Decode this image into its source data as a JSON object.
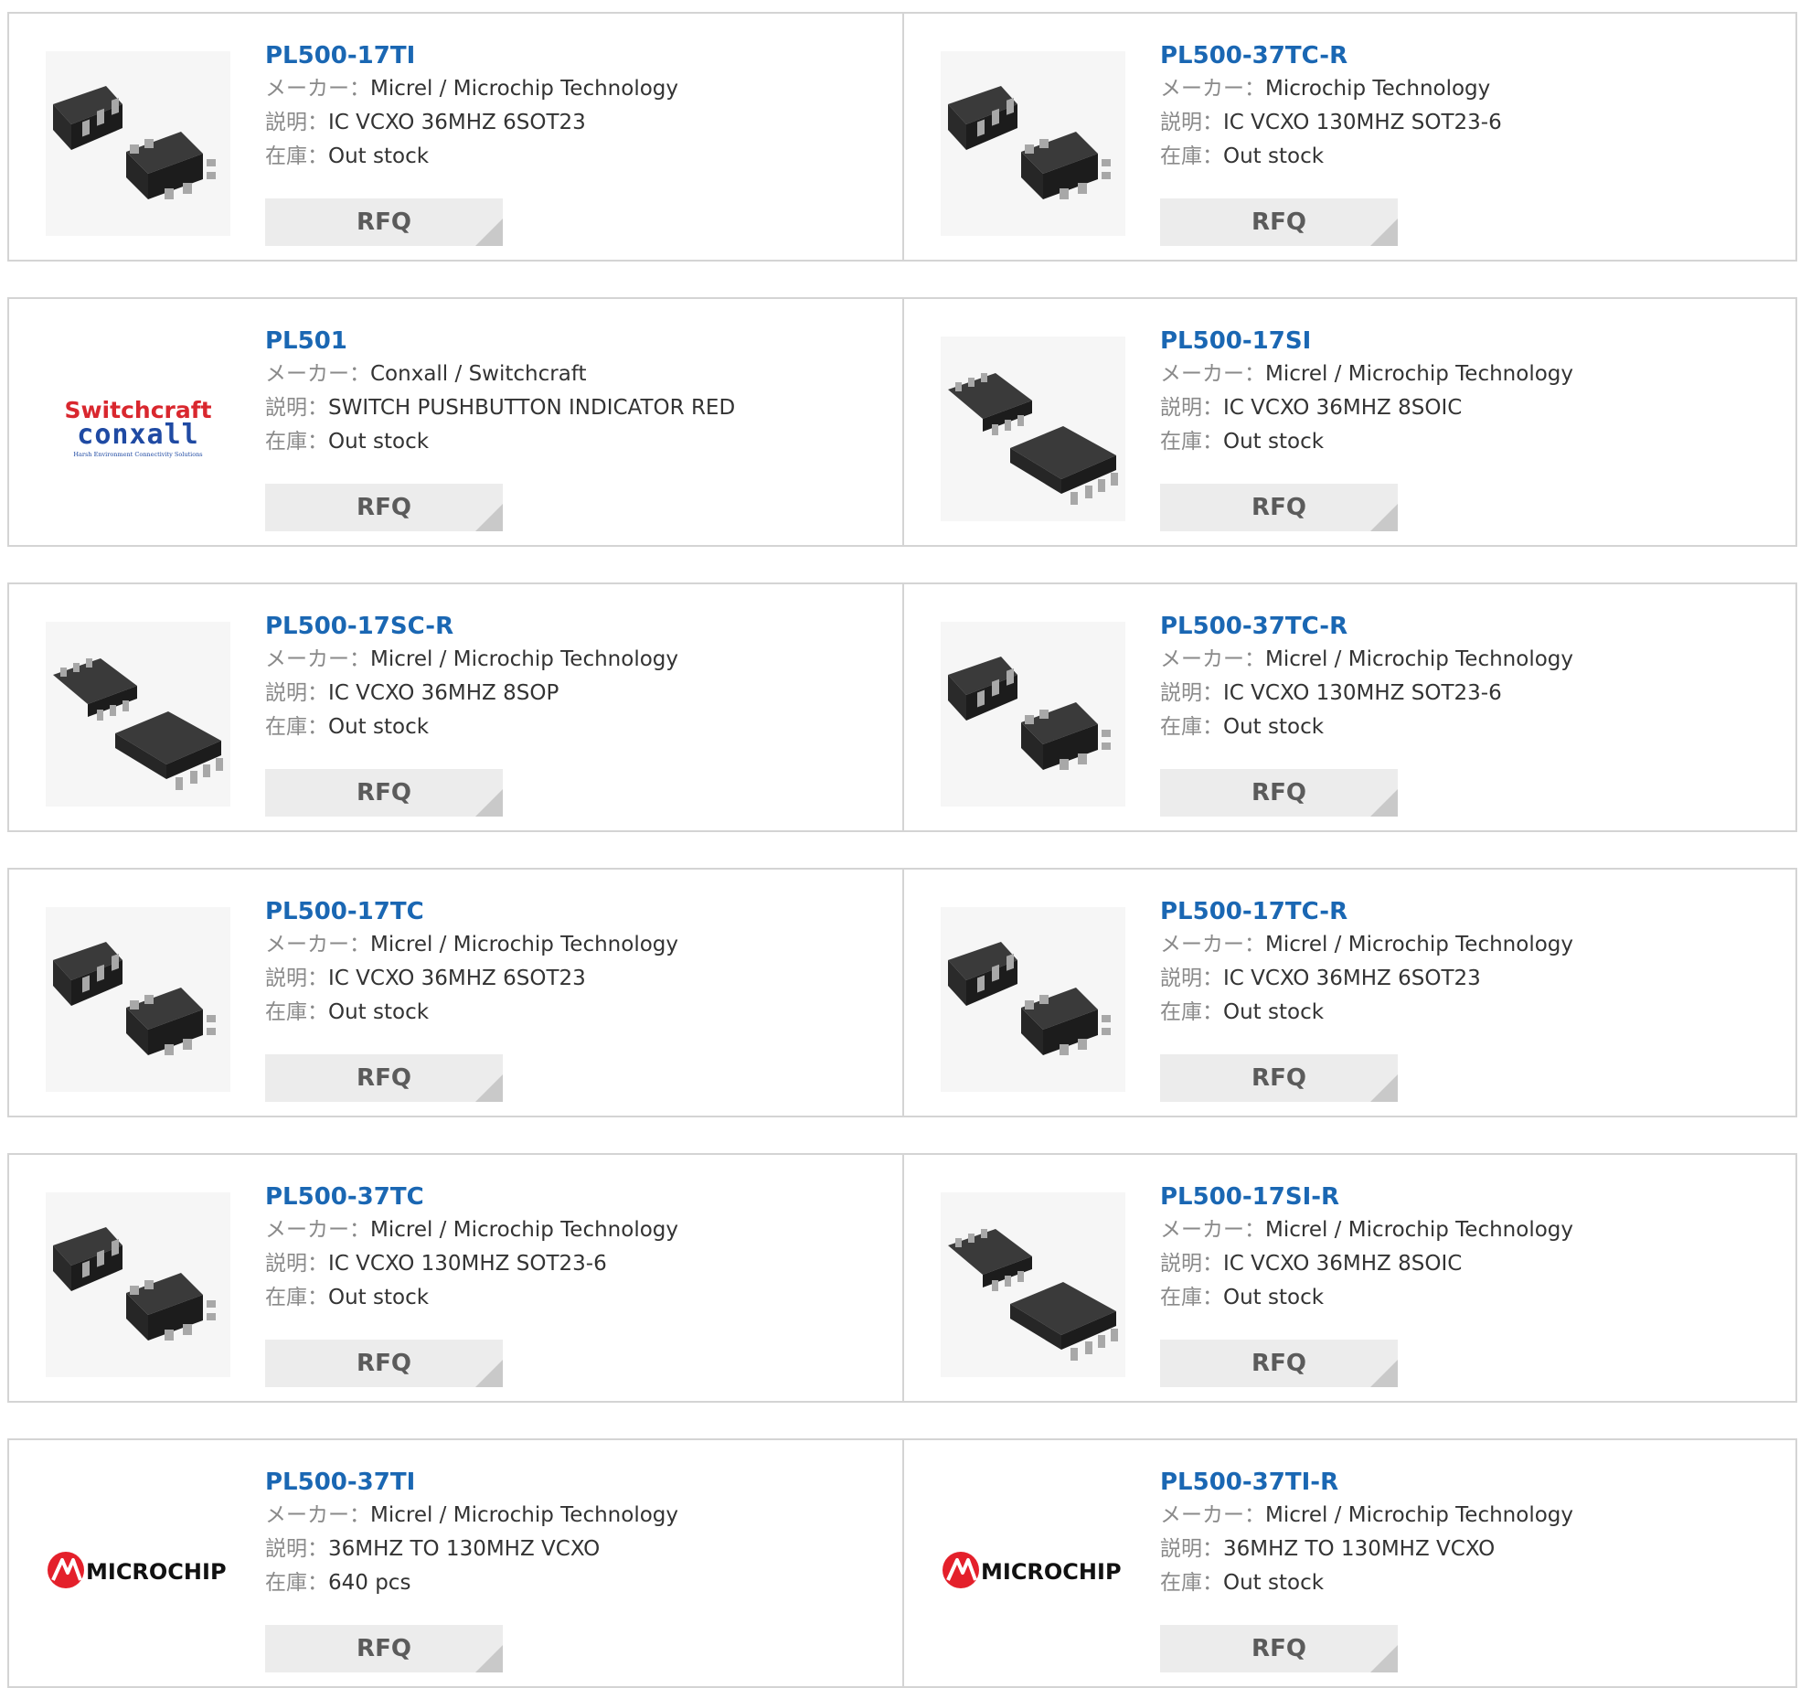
{
  "labels": {
    "maker": "メーカー",
    "desc": "説明",
    "stock": "在庫",
    "rfq": "RFQ"
  },
  "products": [
    {
      "part": "PL500-17TI",
      "maker": "Micrel / Microchip Technology",
      "desc": "IC VCXO 36MHZ 6SOT23",
      "stock": "Out stock",
      "image": "sot23-chip"
    },
    {
      "part": "PL500-37TC-R",
      "maker": "Microchip Technology",
      "desc": "IC VCXO 130MHZ SOT23-6",
      "stock": "Out stock",
      "image": "sot23-chip"
    },
    {
      "part": "PL501",
      "maker": "Conxall / Switchcraft",
      "desc": "SWITCH PUSHBUTTON INDICATOR RED",
      "stock": "Out stock",
      "image": "switchcraft-logo",
      "logo_text": {
        "line1": "Switchcraft",
        "line2": "conxall",
        "tagline": "Harsh Environment Connectivity Solutions"
      }
    },
    {
      "part": "PL500-17SI",
      "maker": "Micrel / Microchip Technology",
      "desc": "IC VCXO 36MHZ 8SOIC",
      "stock": "Out stock",
      "image": "soic-chip"
    },
    {
      "part": "PL500-17SC-R",
      "maker": "Micrel / Microchip Technology",
      "desc": "IC VCXO 36MHZ 8SOP",
      "stock": "Out stock",
      "image": "soic-chip"
    },
    {
      "part": "PL500-37TC-R",
      "maker": "Micrel / Microchip Technology",
      "desc": "IC VCXO 130MHZ SOT23-6",
      "stock": "Out stock",
      "image": "sot23-chip"
    },
    {
      "part": "PL500-17TC",
      "maker": "Micrel / Microchip Technology",
      "desc": "IC VCXO 36MHZ 6SOT23",
      "stock": "Out stock",
      "image": "sot23-chip"
    },
    {
      "part": "PL500-17TC-R",
      "maker": "Micrel / Microchip Technology",
      "desc": "IC VCXO 36MHZ 6SOT23",
      "stock": "Out stock",
      "image": "sot23-chip"
    },
    {
      "part": "PL500-37TC",
      "maker": "Micrel / Microchip Technology",
      "desc": "IC VCXO 130MHZ SOT23-6",
      "stock": "Out stock",
      "image": "sot23-chip"
    },
    {
      "part": "PL500-17SI-R",
      "maker": "Micrel / Microchip Technology",
      "desc": "IC VCXO 36MHZ 8SOIC",
      "stock": "Out stock",
      "image": "soic-chip"
    },
    {
      "part": "PL500-37TI",
      "maker": "Micrel / Microchip Technology",
      "desc": "36MHZ TO 130MHZ VCXO",
      "stock": "640 pcs",
      "image": "microchip-logo",
      "logo_text": {
        "wordmark": "MICROCHIP"
      }
    },
    {
      "part": "PL500-37TI-R",
      "maker": "Micrel / Microchip Technology",
      "desc": "36MHZ TO 130MHZ VCXO",
      "stock": "Out stock",
      "image": "microchip-logo",
      "logo_text": {
        "wordmark": "MICROCHIP"
      }
    }
  ],
  "colors": {
    "part_link": "#1a67b3",
    "label": "#8a8a8a",
    "value": "#333333",
    "border": "#d4d4d4",
    "rfq_bg": "#ececec",
    "logo_red": "#e4202b"
  }
}
